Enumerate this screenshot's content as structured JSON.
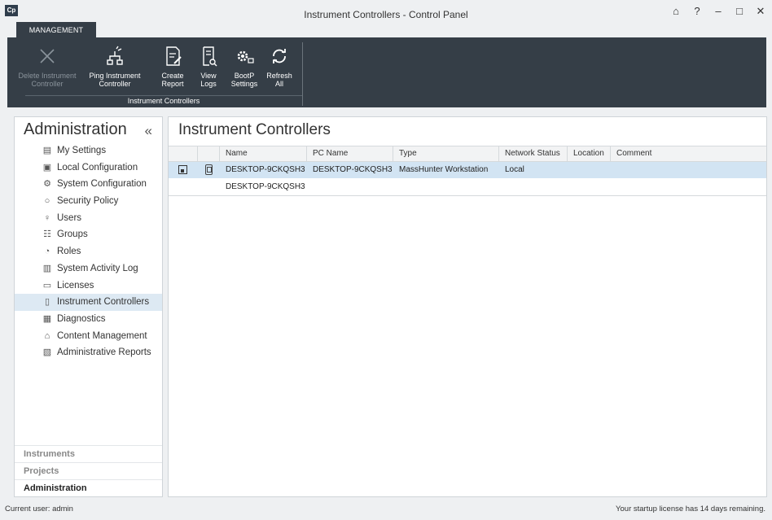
{
  "window": {
    "title": "Instrument Controllers - Control Panel",
    "logo": "Cp",
    "controls": [
      "lock-icon",
      "help-icon",
      "minimize-icon",
      "maximize-icon",
      "close-icon"
    ],
    "control_glyphs": [
      "⌂",
      "?",
      "–",
      "□",
      "✕"
    ]
  },
  "ribbon": {
    "tab": "MANAGEMENT",
    "buttons": [
      {
        "label1": "Delete Instrument",
        "label2": "Controller",
        "icon": "delete-icon",
        "disabled": true
      },
      {
        "label1": "Ping Instrument",
        "label2": "Controller",
        "icon": "network-ping-icon",
        "disabled": false
      },
      {
        "label1": "Create",
        "label2": "Report",
        "icon": "create-report-icon",
        "disabled": false
      },
      {
        "label1": "View",
        "label2": "Logs",
        "icon": "view-logs-icon",
        "disabled": false
      },
      {
        "label1": "BootP",
        "label2": "Settings",
        "icon": "bootp-settings-icon",
        "disabled": false
      },
      {
        "label1": "Refresh",
        "label2": "All",
        "icon": "refresh-icon",
        "disabled": false
      }
    ],
    "group_label": "Instrument Controllers"
  },
  "sidebar": {
    "title": "Administration",
    "collapse_glyph": "«",
    "items": [
      {
        "label": "My Settings",
        "icon": "my-settings-icon",
        "glyph": "▤"
      },
      {
        "label": "Local Configuration",
        "icon": "local-configuration-icon",
        "glyph": "▣"
      },
      {
        "label": "System Configuration",
        "icon": "gear-icon",
        "glyph": "⚙"
      },
      {
        "label": "Security Policy",
        "icon": "shield-icon",
        "glyph": "○"
      },
      {
        "label": "Users",
        "icon": "user-icon",
        "glyph": "♀"
      },
      {
        "label": "Groups",
        "icon": "group-icon",
        "glyph": "☷"
      },
      {
        "label": "Roles",
        "icon": "roles-icon",
        "glyph": "◔"
      },
      {
        "label": "System Activity Log",
        "icon": "activity-log-icon",
        "glyph": "▥"
      },
      {
        "label": "Licenses",
        "icon": "license-icon",
        "glyph": "▭"
      },
      {
        "label": "Instrument Controllers",
        "icon": "instrument-controller-icon",
        "glyph": "▯",
        "active": true
      },
      {
        "label": "Diagnostics",
        "icon": "diagnostics-icon",
        "glyph": "▦"
      },
      {
        "label": "Content Management",
        "icon": "content-management-icon",
        "glyph": "⌂"
      },
      {
        "label": "Administrative Reports",
        "icon": "administrative-reports-icon",
        "glyph": "▧"
      }
    ],
    "bottom": [
      {
        "label": "Instruments"
      },
      {
        "label": "Projects"
      },
      {
        "label": "Administration",
        "selected": true
      }
    ]
  },
  "main": {
    "title": "Instrument Controllers",
    "columns": [
      "",
      "",
      "Name",
      "PC Name",
      "Type",
      "Network Status",
      "Location",
      "Comment"
    ],
    "rows": [
      {
        "name": "DESKTOP-9CKQSH3",
        "pc_name": "DESKTOP-9CKQSH3",
        "type": "MassHunter Workstation",
        "network_status": "Local",
        "location": "",
        "comment": ""
      }
    ],
    "detail": "DESKTOP-9CKQSH3"
  },
  "status": {
    "user": "Current user: admin",
    "license": "Your startup license has 14 days remaining."
  },
  "colors": {
    "ribbon_bg": "#353e47",
    "selected_row": "#d2e4f3",
    "active_nav": "#dde9f3"
  }
}
